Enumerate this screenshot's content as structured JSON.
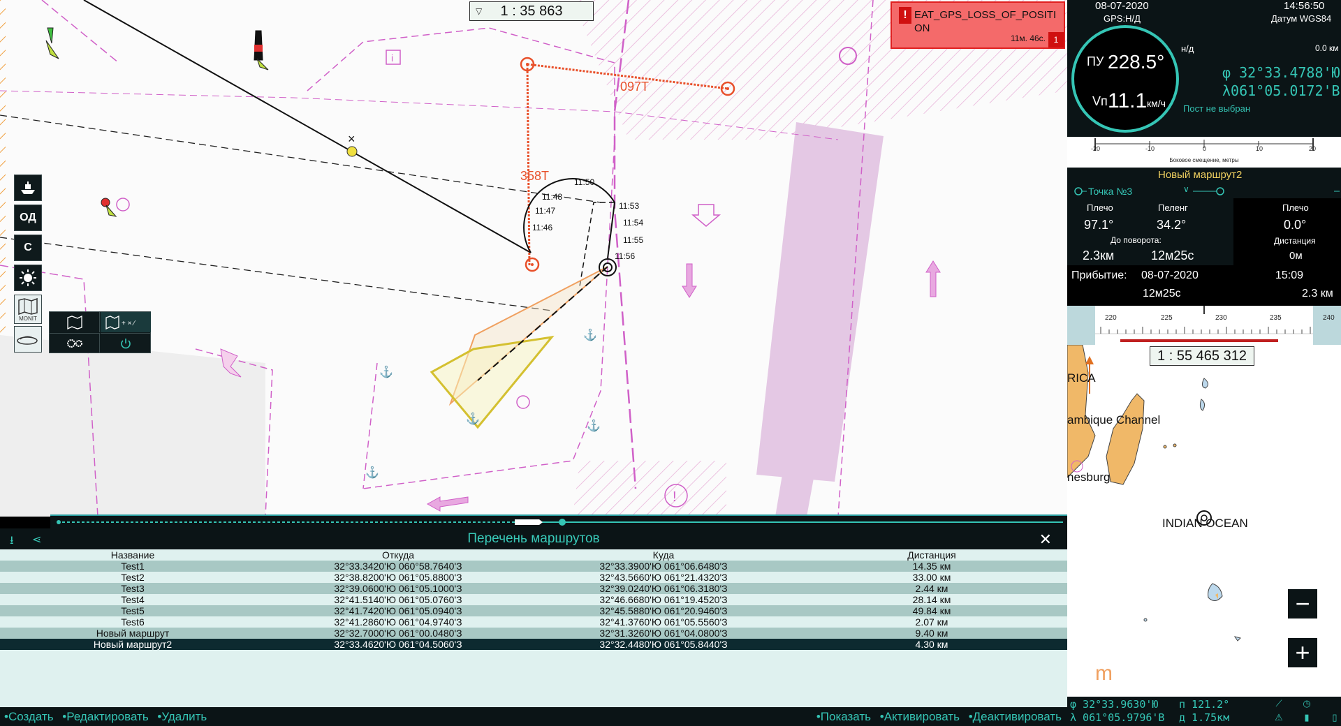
{
  "chart": {
    "scale": "1 : 35 863",
    "bearing_labels": [
      "097T",
      "358T"
    ],
    "time_marks": [
      "11:50",
      "11:48",
      "11:47",
      "11:46",
      "11:53",
      "11:54",
      "11:55",
      "11:56"
    ]
  },
  "alarm": {
    "text": "EAT_GPS_LOSS_OF_POSITION",
    "age": "11м. 46с.",
    "count": "1"
  },
  "left_toolbar": {
    "od_label": "ОД",
    "c_label": "С",
    "monit_label": "MONIT"
  },
  "route_list": {
    "title": "Перечень маршрутов",
    "columns": [
      "Название",
      "Откуда",
      "Куда",
      "Дистанция"
    ],
    "rows": [
      {
        "name": "Test1",
        "from": "32°33.3420'Ю 060°58.7640'З",
        "to": "32°33.3900'Ю 061°06.6480'З",
        "dist": "14.35 км"
      },
      {
        "name": "Test2",
        "from": "32°38.8200'Ю 061°05.8800'З",
        "to": "32°43.5660'Ю 061°21.4320'З",
        "dist": "33.00 км"
      },
      {
        "name": "Test3",
        "from": "32°39.0600'Ю 061°05.1000'З",
        "to": "32°39.0240'Ю 061°06.3180'З",
        "dist": "2.44 км"
      },
      {
        "name": "Test4",
        "from": "32°41.5140'Ю 061°05.0760'З",
        "to": "32°46.6680'Ю 061°19.4520'З",
        "dist": "28.14 км"
      },
      {
        "name": "Test5",
        "from": "32°41.7420'Ю 061°05.0940'З",
        "to": "32°45.5880'Ю 061°20.9460'З",
        "dist": "49.84 км"
      },
      {
        "name": "Test6",
        "from": "32°41.2860'Ю 061°04.9740'З",
        "to": "32°41.3760'Ю 061°05.5560'З",
        "dist": "2.07 км"
      },
      {
        "name": "Новый маршрут",
        "from": "32°32.7000'Ю 061°00.0480'З",
        "to": "32°31.3260'Ю 061°04.0800'З",
        "dist": "9.40 км"
      },
      {
        "name": "Новый маршрут2",
        "from": "32°33.4620'Ю 061°04.5060'З",
        "to": "32°32.4480'Ю 061°05.8440'З",
        "dist": "4.30 км"
      }
    ],
    "selected_index": 7
  },
  "bottom_actions": {
    "create": "•Создать",
    "edit": "•Редактировать",
    "delete": "•Удалить",
    "show": "•Показать",
    "activate": "•Активировать",
    "deactivate": "•Деактивировать"
  },
  "nav": {
    "date": "08-07-2020",
    "time": "14:56:50",
    "gps": "GPS:Н/Д",
    "datum": "Датум WGS84",
    "heading_label": "ПУ",
    "heading_value": "228.5°",
    "speed_label": "Vп",
    "speed_value": "11.1",
    "speed_unit": "км/ч",
    "nd": "н/д",
    "nd_km": "0.0 км",
    "lat": "φ 32°33.4788'Ю",
    "lon": "λ061°05.0172'В",
    "post": "Пост не выбран"
  },
  "offset": {
    "label": "Боковое смещение, метры",
    "ticks": [
      "-20",
      "-10",
      "0",
      "10",
      "20"
    ]
  },
  "route_panel": {
    "route_name": "Новый маршрут2",
    "point": "Точка №3",
    "arm_label": "Плечо",
    "arm_value": "97.1°",
    "bearing_label": "Пеленг",
    "bearing_value": "34.2°",
    "to_turn_label": "До поворота:",
    "to_turn_dist": "2.3км",
    "to_turn_time": "12м25с",
    "arm2_label": "Плечо",
    "arm2_value": "0.0°",
    "distance_label": "Дистанция",
    "distance_value": "0м"
  },
  "arrival": {
    "label": "Прибытие:",
    "date": "08-07-2020",
    "time": "15:09",
    "duration": "12м25с",
    "distance": "2.3 км"
  },
  "heading_scale": {
    "ticks": [
      "220",
      "225",
      "230",
      "235",
      "240"
    ]
  },
  "minimap": {
    "scale": "1 : 55 465 312",
    "labels": [
      "RICA",
      "ambique Channel",
      "nesburg",
      "INDIAN OCEAN"
    ],
    "logo": "m",
    "zoom_out": "−",
    "zoom_in": "+"
  },
  "status_bar": {
    "lat": "φ  32°33.9630'Ю",
    "lon": "λ 061°05.9796'В",
    "bearing": "п 121.2°",
    "dist": "д 1.75км"
  }
}
